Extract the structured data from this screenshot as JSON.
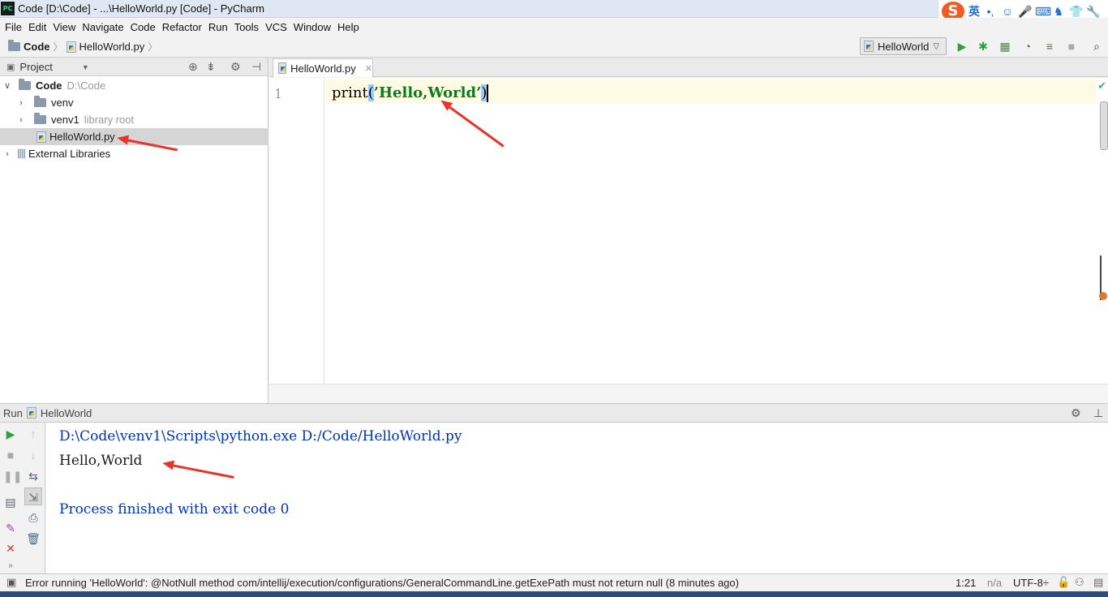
{
  "window": {
    "title": "Code [D:\\Code] - ...\\HelloWorld.py [Code] - PyCharm",
    "logo_text": "PC"
  },
  "ime": {
    "logo": "S",
    "lang": "英",
    "punct": "•,",
    "emoji": "☺",
    "mic": "🎤",
    "keyboard": "⌨",
    "skin": "♞",
    "tshirt": "👕",
    "tools": "🔧"
  },
  "menu": [
    "File",
    "Edit",
    "View",
    "Navigate",
    "Code",
    "Refactor",
    "Run",
    "Tools",
    "VCS",
    "Window",
    "Help"
  ],
  "navbar": {
    "root": "Code",
    "file": "HelloWorld.py",
    "run_config": "HelloWorld"
  },
  "project": {
    "header": "Project",
    "root_name": "Code",
    "root_path": "D:\\Code",
    "items": [
      {
        "label": "venv",
        "note": ""
      },
      {
        "label": "venv1",
        "note": "library root"
      },
      {
        "label": "HelloWorld.py",
        "note": ""
      },
      {
        "label": "External Libraries",
        "note": ""
      }
    ]
  },
  "editor": {
    "tab": "HelloWorld.py",
    "line_number": "1",
    "code_prefix": "print",
    "code_open": "(",
    "code_string": "’Hello,World’",
    "code_close": ")"
  },
  "run": {
    "header_label": "Run",
    "config": "HelloWorld",
    "console": {
      "command": "D:\\Code\\venv1\\Scripts\\python.exe D:/Code/HelloWorld.py",
      "output": "Hello,World",
      "finish": "Process finished with exit code 0"
    }
  },
  "status": {
    "message": "Error running 'HelloWorld': @NotNull method com/intellij/execution/configurations/GeneralCommandLine.getExePath must not return null (8 minutes ago)",
    "position": "1:21",
    "na": "n/a",
    "encoding": "UTF-8÷"
  },
  "colors": {
    "string": "#067d17",
    "console_blue": "#0033b3",
    "arrow": "#e8352b",
    "selection": "#d5d5d5"
  }
}
